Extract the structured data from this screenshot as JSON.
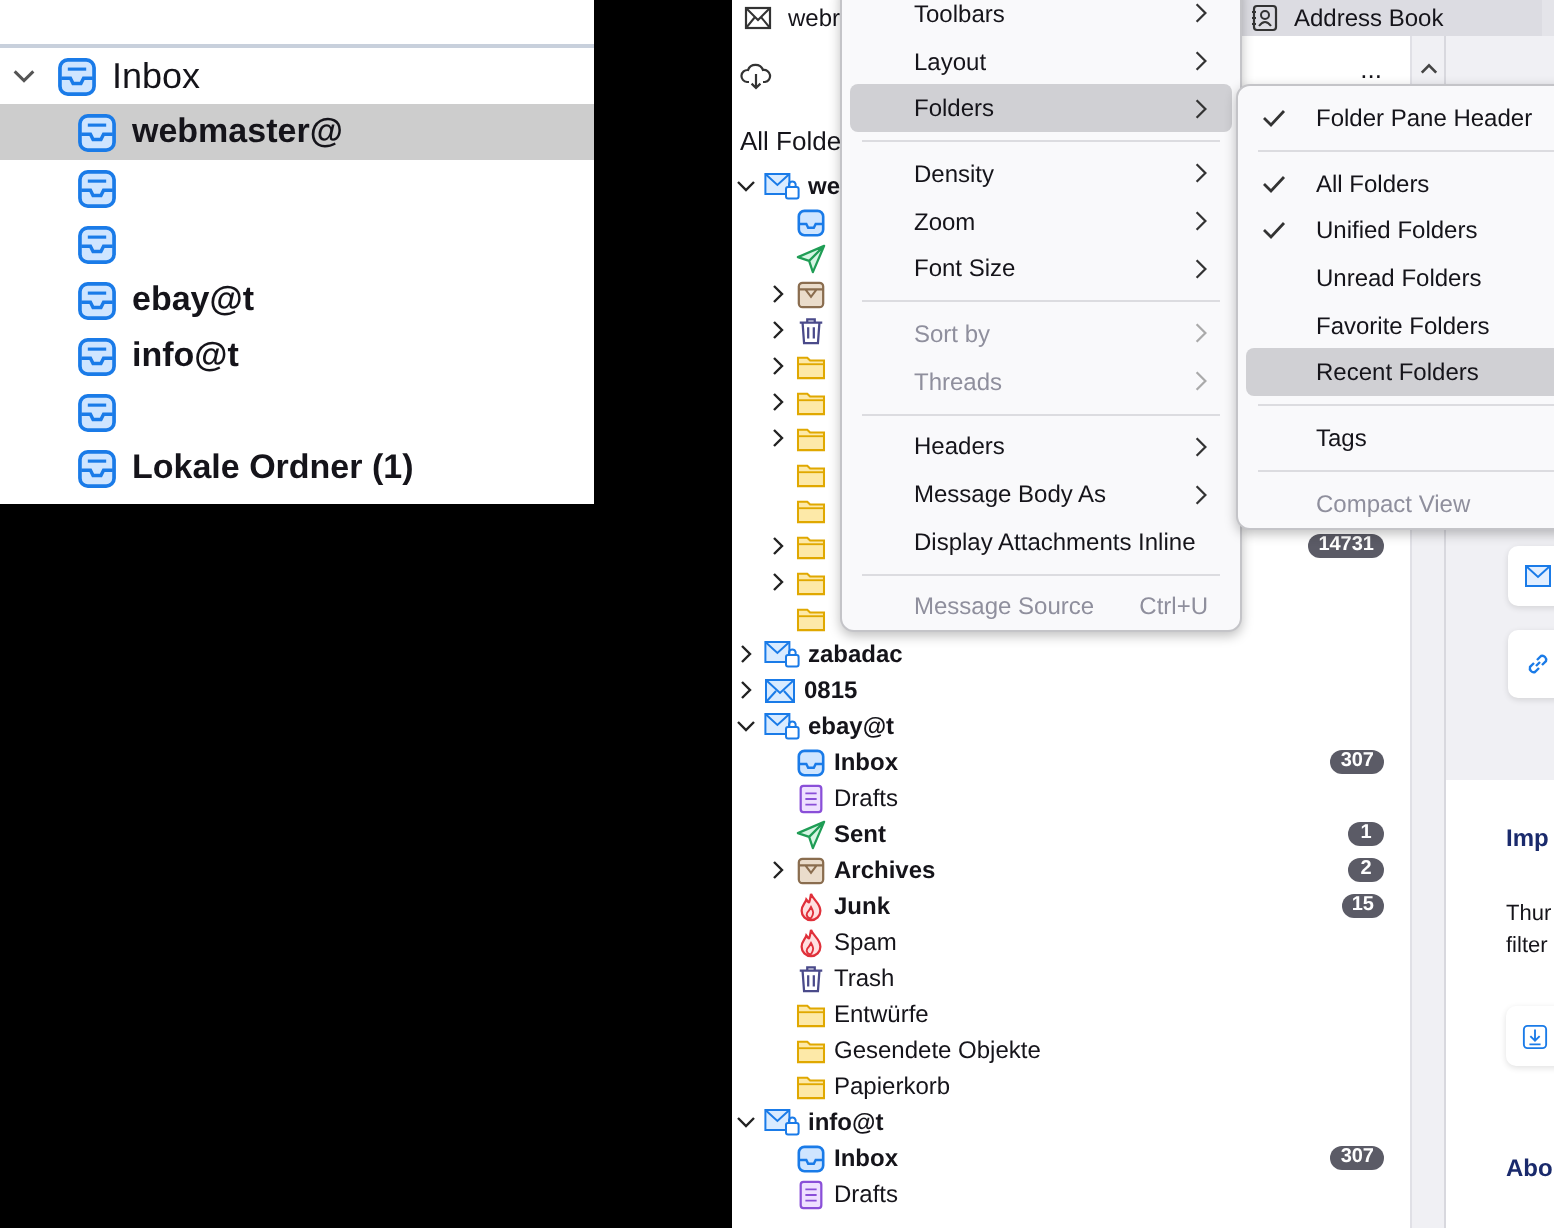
{
  "left_panel": {
    "tree": {
      "label": "Inbox",
      "expanded": true,
      "children": [
        {
          "label": "webmaster@",
          "selected": true
        },
        {
          "selected": false
        },
        {
          "selected": false
        },
        {
          "label": "ebay@t",
          "selected": false
        },
        {
          "label": "info@t",
          "selected": false
        },
        {
          "selected": false
        },
        {
          "label": "Lokale Ordner (1)",
          "selected": false
        }
      ]
    }
  },
  "right_window": {
    "tabs": [
      {
        "label": "webr",
        "selected": true
      },
      {
        "label": "Address Book",
        "selected": false
      }
    ],
    "folder_pane": {
      "pane_menu": "...",
      "title": "All Folde",
      "tree": [
        {
          "kind": "account",
          "label": "we",
          "unread": true,
          "expanded": true,
          "children": [
            {
              "kind": "inbox"
            },
            {
              "kind": "sent"
            },
            {
              "kind": "archive",
              "expanded": false
            },
            {
              "kind": "trash",
              "expanded": false
            },
            {
              "kind": "folder",
              "expanded": false
            },
            {
              "kind": "folder",
              "expanded": false
            },
            {
              "kind": "folder",
              "expanded": false
            },
            {
              "kind": "folder"
            },
            {
              "kind": "folder"
            },
            {
              "kind": "folder",
              "expanded": false,
              "count": "14731"
            },
            {
              "kind": "folder",
              "expanded": false
            },
            {
              "kind": "folder"
            }
          ]
        },
        {
          "kind": "account",
          "label": "zabadac",
          "unread": true,
          "expanded": false
        },
        {
          "kind": "mail",
          "label": "0815",
          "unread": true,
          "expanded": false
        },
        {
          "kind": "account",
          "label": "ebay@t",
          "unread": true,
          "expanded": true,
          "children": [
            {
              "kind": "inbox",
              "label": "Inbox",
              "unread": true,
              "count": "307"
            },
            {
              "kind": "drafts",
              "label": "Drafts",
              "unread": false
            },
            {
              "kind": "sent",
              "label": "Sent",
              "unread": true,
              "count": "1"
            },
            {
              "kind": "archive",
              "label": "Archives",
              "unread": true,
              "expanded": false,
              "count": "2"
            },
            {
              "kind": "junk",
              "label": "Junk",
              "unread": true,
              "count": "15"
            },
            {
              "kind": "junk",
              "label": "Spam",
              "unread": false
            },
            {
              "kind": "trash",
              "label": "Trash",
              "unread": false
            },
            {
              "kind": "folder",
              "label": "Entwürfe",
              "unread": false
            },
            {
              "kind": "folder",
              "label": "Gesendete Objekte",
              "unread": false
            },
            {
              "kind": "folder",
              "label": "Papierkorb",
              "unread": false
            }
          ]
        },
        {
          "kind": "account",
          "label": "info@t",
          "unread": true,
          "expanded": true,
          "children": [
            {
              "kind": "inbox",
              "label": "Inbox",
              "unread": true,
              "count": "307"
            },
            {
              "kind": "drafts",
              "label": "Drafts",
              "unread": false
            }
          ]
        }
      ]
    },
    "start_page": {
      "heading_1": "Imp",
      "text_lines": [
        "Thur",
        "filter"
      ],
      "heading_2": "Abo"
    },
    "view_menu": {
      "items": [
        {
          "kind": "item",
          "label": "Toolbars",
          "submenu": true,
          "disabled": false,
          "highlighted": false
        },
        {
          "kind": "item",
          "label": "Layout",
          "submenu": true,
          "disabled": false,
          "highlighted": false
        },
        {
          "kind": "item",
          "label": "Folders",
          "submenu": true,
          "disabled": false,
          "highlighted": true
        },
        {
          "kind": "separator"
        },
        {
          "kind": "item",
          "label": "Density",
          "submenu": true,
          "disabled": false,
          "highlighted": false
        },
        {
          "kind": "item",
          "label": "Zoom",
          "submenu": true,
          "disabled": false,
          "highlighted": false
        },
        {
          "kind": "item",
          "label": "Font Size",
          "submenu": true,
          "disabled": false,
          "highlighted": false
        },
        {
          "kind": "separator"
        },
        {
          "kind": "item",
          "label": "Sort by",
          "submenu": true,
          "disabled": true,
          "highlighted": false
        },
        {
          "kind": "item",
          "label": "Threads",
          "submenu": true,
          "disabled": true,
          "highlighted": false
        },
        {
          "kind": "separator"
        },
        {
          "kind": "item",
          "label": "Headers",
          "submenu": true,
          "disabled": false,
          "highlighted": false
        },
        {
          "kind": "item",
          "label": "Message Body As",
          "submenu": true,
          "disabled": false,
          "highlighted": false
        },
        {
          "kind": "item",
          "label": "Display Attachments Inline",
          "submenu": false,
          "disabled": false,
          "highlighted": false
        },
        {
          "kind": "separator"
        },
        {
          "kind": "item",
          "label": "Message Source",
          "shortcut": "Ctrl+U",
          "submenu": false,
          "disabled": true,
          "highlighted": false
        }
      ]
    },
    "folders_submenu": {
      "items": [
        {
          "kind": "item",
          "label": "Folder Pane Header",
          "checked": true,
          "disabled": false,
          "highlighted": false
        },
        {
          "kind": "separator"
        },
        {
          "kind": "item",
          "label": "All Folders",
          "checked": true,
          "disabled": false,
          "highlighted": false
        },
        {
          "kind": "item",
          "label": "Unified Folders",
          "checked": true,
          "disabled": false,
          "highlighted": false
        },
        {
          "kind": "item",
          "label": "Unread Folders",
          "checked": false,
          "disabled": false,
          "highlighted": false
        },
        {
          "kind": "item",
          "label": "Favorite Folders",
          "checked": false,
          "disabled": false,
          "highlighted": false
        },
        {
          "kind": "item",
          "label": "Recent Folders",
          "checked": false,
          "disabled": false,
          "highlighted": true
        },
        {
          "kind": "separator"
        },
        {
          "kind": "item",
          "label": "Tags",
          "checked": false,
          "disabled": false,
          "highlighted": false
        },
        {
          "kind": "separator"
        },
        {
          "kind": "item",
          "label": "Compact View",
          "checked": false,
          "disabled": true,
          "highlighted": false
        }
      ]
    }
  }
}
